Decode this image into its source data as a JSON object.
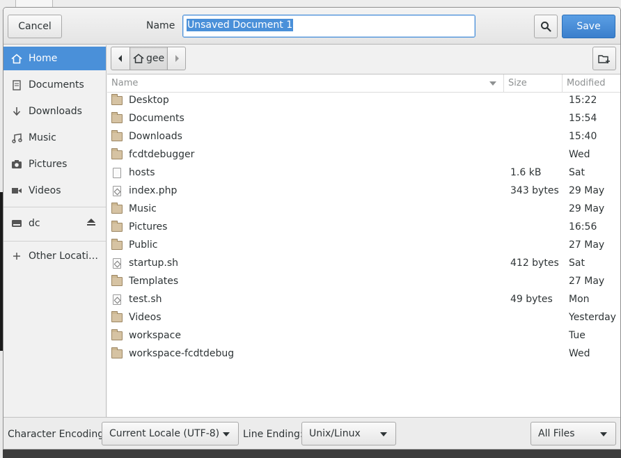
{
  "header": {
    "cancel_label": "Cancel",
    "name_label": "Name",
    "name_value": "Unsaved Document 1",
    "save_label": "Save"
  },
  "sidebar": {
    "items": [
      {
        "label": "Home",
        "icon": "home-icon"
      },
      {
        "label": "Documents",
        "icon": "document-icon"
      },
      {
        "label": "Downloads",
        "icon": "download-icon"
      },
      {
        "label": "Music",
        "icon": "music-icon"
      },
      {
        "label": "Pictures",
        "icon": "camera-icon"
      },
      {
        "label": "Videos",
        "icon": "video-icon"
      },
      {
        "label": "dc",
        "icon": "drive-icon"
      },
      {
        "label": "Other Locati…",
        "icon": "plus-icon"
      }
    ]
  },
  "pathbar": {
    "current": "gee"
  },
  "columns": {
    "name": "Name",
    "size": "Size",
    "modified": "Modified"
  },
  "files": [
    {
      "name": "Desktop",
      "size": "",
      "modified": "15:22",
      "kind": "folder"
    },
    {
      "name": "Documents",
      "size": "",
      "modified": "15:54",
      "kind": "folder"
    },
    {
      "name": "Downloads",
      "size": "",
      "modified": "15:40",
      "kind": "folder"
    },
    {
      "name": "fcdtdebugger",
      "size": "",
      "modified": "Wed",
      "kind": "folder"
    },
    {
      "name": "hosts",
      "size": "1.6 kB",
      "modified": "Sat",
      "kind": "file"
    },
    {
      "name": "index.php",
      "size": "343 bytes",
      "modified": "29 May",
      "kind": "script"
    },
    {
      "name": "Music",
      "size": "",
      "modified": "29 May",
      "kind": "folder"
    },
    {
      "name": "Pictures",
      "size": "",
      "modified": "16:56",
      "kind": "folder"
    },
    {
      "name": "Public",
      "size": "",
      "modified": "27 May",
      "kind": "folder"
    },
    {
      "name": "startup.sh",
      "size": "412 bytes",
      "modified": "Sat",
      "kind": "script"
    },
    {
      "name": "Templates",
      "size": "",
      "modified": "27 May",
      "kind": "folder"
    },
    {
      "name": "test.sh",
      "size": "49 bytes",
      "modified": "Mon",
      "kind": "script"
    },
    {
      "name": "Videos",
      "size": "",
      "modified": "Yesterday",
      "kind": "folder"
    },
    {
      "name": "workspace",
      "size": "",
      "modified": "Tue",
      "kind": "folder"
    },
    {
      "name": "workspace-fcdtdebug",
      "size": "",
      "modified": "Wed",
      "kind": "folder"
    }
  ],
  "footer": {
    "encoding_label": "Character Encoding:",
    "encoding_value": "Current Locale (UTF-8)",
    "line_ending_label": "Line Ending:",
    "line_ending_value": "Unix/Linux",
    "filter_value": "All Files"
  }
}
